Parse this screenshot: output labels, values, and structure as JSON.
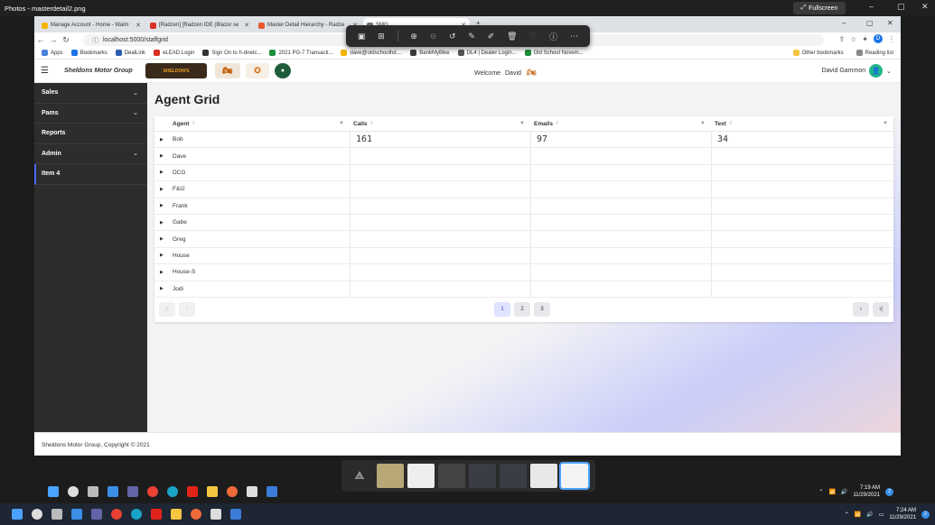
{
  "photos": {
    "title": "Photos - masterdetail2.png",
    "fullscreen_label": "Fullscreen"
  },
  "browser": {
    "tabs": [
      {
        "label": "Manage Account - Home - Walm",
        "color": "#f5b301"
      },
      {
        "label": "[Radzen] [Radzen IDE (Blazor se",
        "color": "#d93025"
      },
      {
        "label": "Master Detail Hierarchy - Radze",
        "color": "#e8572e"
      },
      {
        "label": "SMG",
        "color": "#777777"
      }
    ],
    "url": "localhost:5000/staffgrid",
    "profile_initial": "D",
    "bookmarks": [
      {
        "label": "Apps",
        "color": "#4a7fd8"
      },
      {
        "label": "Bookmarks",
        "color": "#1a73e8"
      },
      {
        "label": "DealLink",
        "color": "#2a5db0"
      },
      {
        "label": "eLEAD Login",
        "color": "#d93025"
      },
      {
        "label": "Sign On to h-dnetc...",
        "color": "#333333"
      },
      {
        "label": "2021 PG-7 Transacti...",
        "color": "#1e8e3e"
      },
      {
        "label": "dave@oldschoolhd....",
        "color": "#f5b301"
      },
      {
        "label": "BankMyBike",
        "color": "#3b3b3b"
      },
      {
        "label": "DL4 | Dealer Login...",
        "color": "#555555"
      },
      {
        "label": "Old School Novem...",
        "color": "#1e8e3e"
      }
    ],
    "other_bookmarks": "Other bookmarks",
    "reading_list": "Reading list"
  },
  "app": {
    "brand": "Sheldons Motor Group",
    "welcome_text": "Welcome",
    "welcome_user": "David",
    "user_name": "David Gammon",
    "sidebar": [
      {
        "label": "Sales",
        "expandable": true
      },
      {
        "label": "Pams",
        "expandable": true
      },
      {
        "label": "Reports",
        "expandable": false
      },
      {
        "label": "Admin",
        "expandable": true
      },
      {
        "label": "Item 4",
        "expandable": false
      }
    ],
    "page_title": "Agent Grid",
    "columns": [
      "Agent",
      "Calls",
      "Emails",
      "Text"
    ],
    "rows": [
      {
        "agent": "Bob",
        "calls": "161",
        "emails": "97",
        "text": "34"
      },
      {
        "agent": "Dave",
        "calls": "",
        "emails": "",
        "text": ""
      },
      {
        "agent": "DCG",
        "calls": "",
        "emails": "",
        "text": ""
      },
      {
        "agent": "F&I2",
        "calls": "",
        "emails": "",
        "text": ""
      },
      {
        "agent": "Frank",
        "calls": "",
        "emails": "",
        "text": ""
      },
      {
        "agent": "Gabe",
        "calls": "",
        "emails": "",
        "text": ""
      },
      {
        "agent": "Greg",
        "calls": "",
        "emails": "",
        "text": ""
      },
      {
        "agent": "House",
        "calls": "",
        "emails": "",
        "text": ""
      },
      {
        "agent": "House-S",
        "calls": "",
        "emails": "",
        "text": ""
      },
      {
        "agent": "Jodi",
        "calls": "",
        "emails": "",
        "text": ""
      }
    ],
    "pages": [
      "1",
      "2",
      "3"
    ],
    "current_page": "1",
    "footer": "Sheldons Motor Group, Copyright © 2021"
  },
  "taskbar": {
    "inner_time": "7:19 AM",
    "inner_date": "11/29/2021",
    "outer_time": "7:24 AM",
    "outer_date": "11/29/2021",
    "notifications": "2"
  }
}
